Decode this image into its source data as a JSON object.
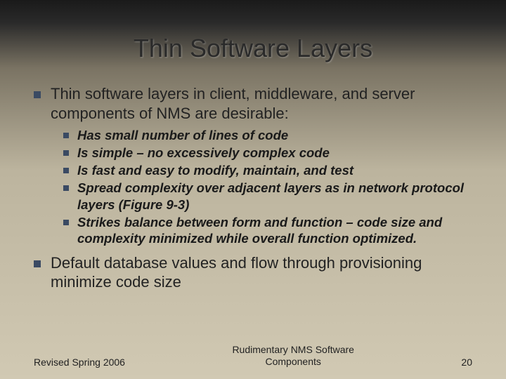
{
  "title": "Thin Software Layers",
  "bullets": {
    "b1": "Thin software layers in client, middleware, and server components of NMS are desirable:",
    "sub": {
      "s1": "Has small number of lines of code",
      "s2": "Is simple – no excessively complex code",
      "s3": "Is fast and easy to modify, maintain, and test",
      "s4": "Spread complexity over adjacent layers as in network protocol layers (Figure 9-3)",
      "s5": "Strikes balance between form and function – code size and complexity minimized while overall function optimized."
    },
    "b2": "Default database values and flow through provisioning minimize code size"
  },
  "footer": {
    "left": "Revised Spring 2006",
    "center": "Rudimentary NMS Software Components",
    "right": "20"
  }
}
